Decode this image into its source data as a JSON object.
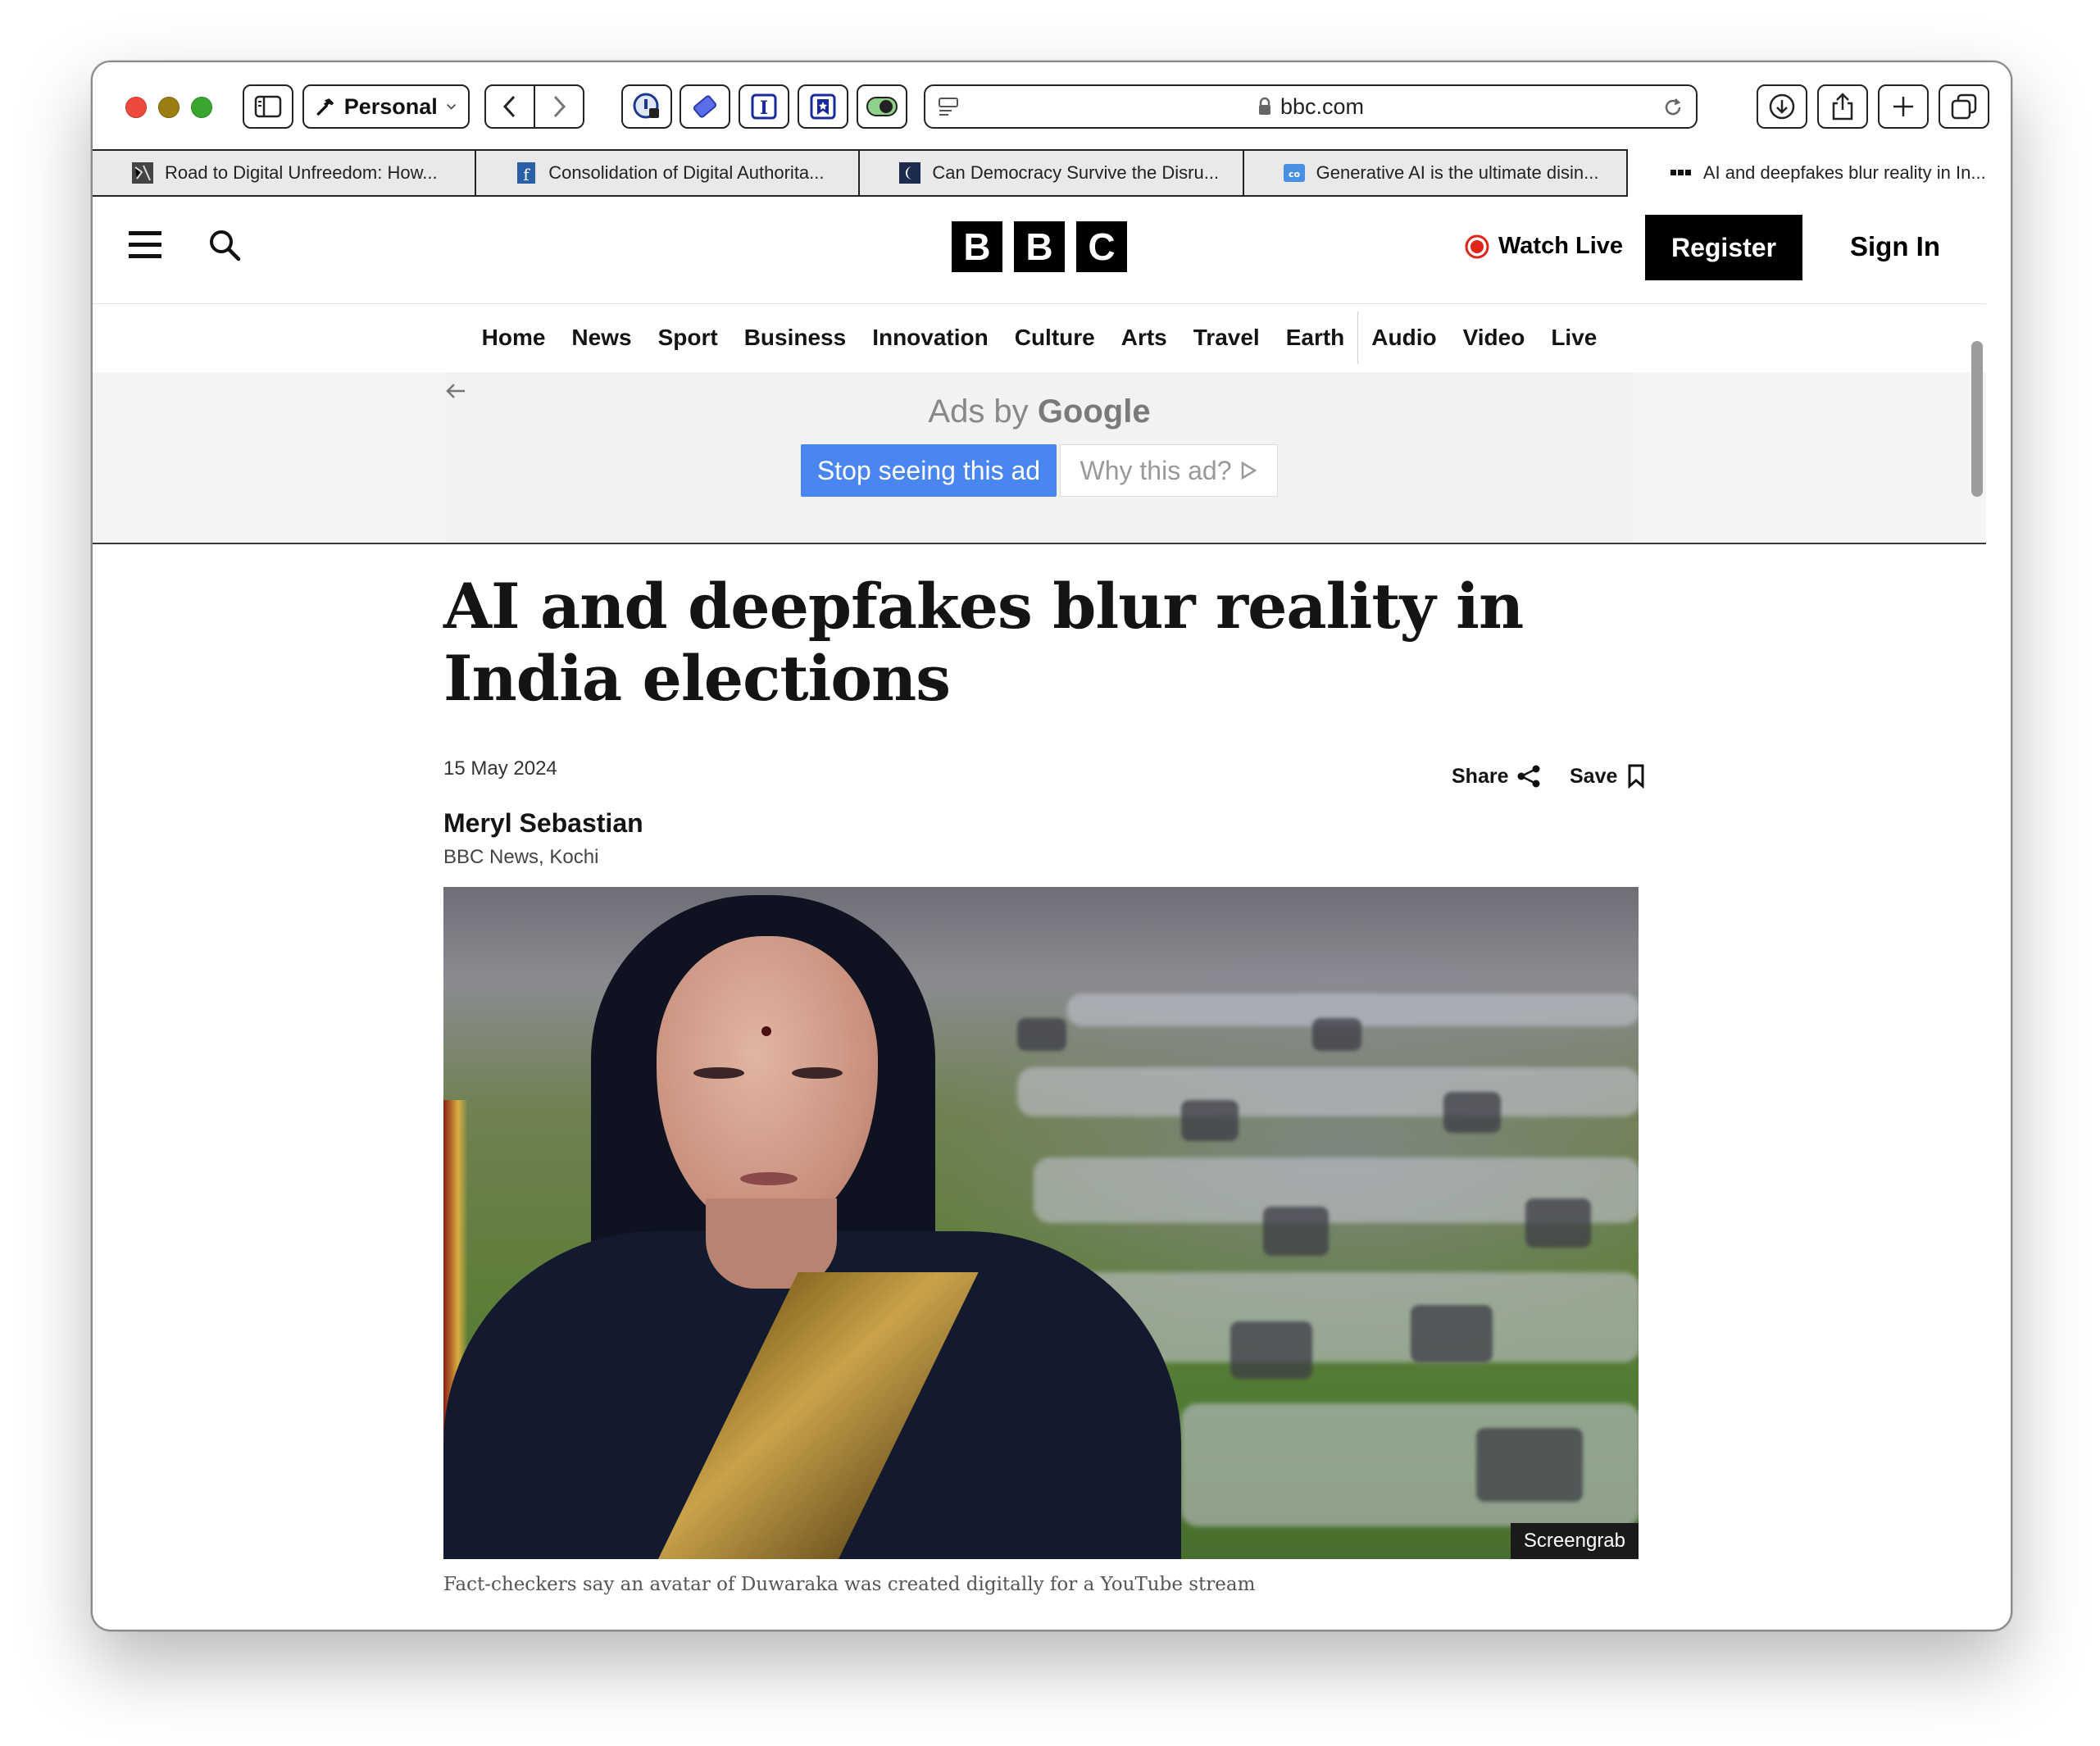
{
  "browser": {
    "profile_label": "Personal",
    "url": "bbc.com",
    "tabs": [
      {
        "title": "Road to Digital Unfreedom: How...",
        "favicon": "journal-icon",
        "active": false
      },
      {
        "title": "Consolidation of Digital Authorita...",
        "favicon": "f-icon",
        "active": false
      },
      {
        "title": "Can Democracy Survive the Disru...",
        "favicon": "half-moon-icon",
        "active": false
      },
      {
        "title": "Generative AI is the ultimate disin...",
        "favicon": "cloud-icon",
        "active": false
      },
      {
        "title": "AI and deepfakes blur reality in In...",
        "favicon": "bbc-icon",
        "active": true
      }
    ]
  },
  "masthead": {
    "logo_letters": [
      "B",
      "B",
      "C"
    ],
    "watch_live": "Watch Live",
    "register": "Register",
    "sign_in": "Sign In"
  },
  "nav": {
    "items": [
      "Home",
      "News",
      "Sport",
      "Business",
      "Innovation",
      "Culture",
      "Arts",
      "Travel",
      "Earth",
      "Audio",
      "Video",
      "Live"
    ]
  },
  "ad": {
    "ads_by": "Ads by",
    "google": "Google",
    "stop_label": "Stop seeing this ad",
    "why_label": "Why this ad?"
  },
  "article": {
    "headline": "AI and deepfakes blur reality in India elections",
    "date": "15 May 2024",
    "share_label": "Share",
    "save_label": "Save",
    "author": "Meryl Sebastian",
    "author_sub": "BBC News, Kochi",
    "image_credit": "Screengrab",
    "caption": "Fact-checkers say an avatar of Duwaraka was created digitally for a YouTube stream"
  },
  "colors": {
    "live_dot": "#e0261b",
    "ad_button": "#4a86f0"
  }
}
